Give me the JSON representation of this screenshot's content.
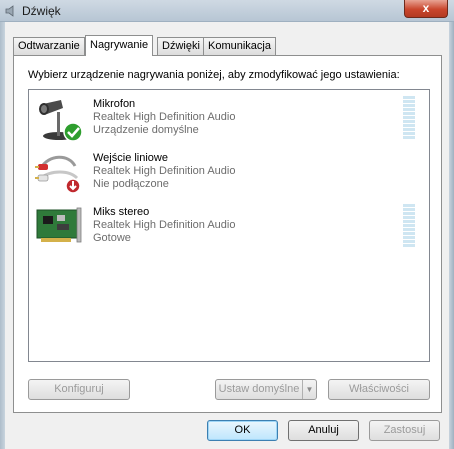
{
  "window": {
    "title": "Dźwięk",
    "close_glyph": "x"
  },
  "tabs": [
    {
      "label": "Odtwarzanie"
    },
    {
      "label": "Nagrywanie"
    },
    {
      "label": "Dźwięki"
    },
    {
      "label": "Komunikacja"
    }
  ],
  "active_tab": "Nagrywanie",
  "instruction": "Wybierz urządzenie nagrywania poniżej, aby zmodyfikować jego ustawienia:",
  "devices": [
    {
      "name": "Mikrofon",
      "driver": "Realtek High Definition Audio",
      "status": "Urządzenie domyślne",
      "icon": "microphone-icon",
      "badge": "default-check-icon",
      "level": 0
    },
    {
      "name": "Wejście liniowe",
      "driver": "Realtek High Definition Audio",
      "status": "Nie podłączone",
      "icon": "line-in-cable-icon",
      "badge": "unplugged-arrow-icon"
    },
    {
      "name": "Miks stereo",
      "driver": "Realtek High Definition Audio",
      "status": "Gotowe",
      "icon": "sound-card-icon",
      "level": 0
    }
  ],
  "panel_buttons": {
    "configure": "Konfiguruj",
    "set_default": "Ustaw domyślne",
    "properties": "Właściwości"
  },
  "dialog_buttons": {
    "ok": "OK",
    "cancel": "Anuluj",
    "apply": "Zastosuj"
  },
  "colors": {
    "level_meter": "#cfe6f2",
    "check_badge": "#2e9e2e",
    "unplugged_badge": "#c0282d"
  }
}
